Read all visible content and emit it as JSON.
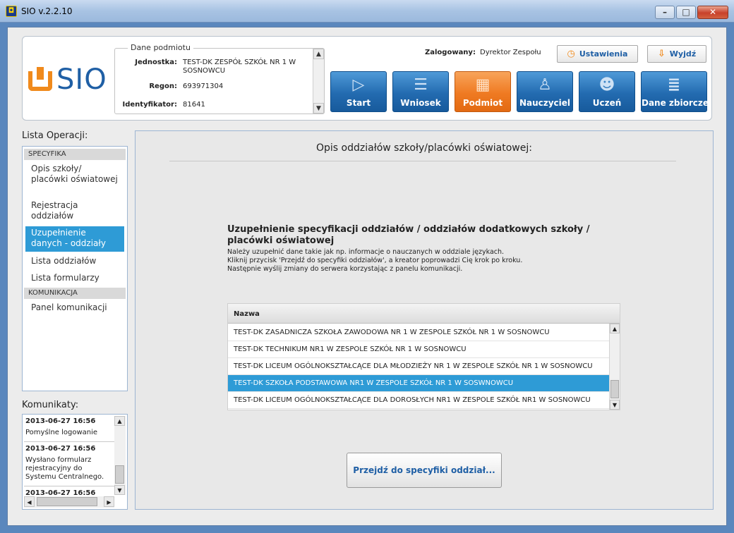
{
  "window": {
    "title": "SIO v.2.2.10"
  },
  "logo": {
    "text": "SIO"
  },
  "header": {
    "dane_title": "Dane podmiotu",
    "fields": [
      {
        "label": "Jednostka:",
        "value": "TEST-DK ZESPÓŁ SZKÓŁ NR 1 W SOSNOWCU"
      },
      {
        "label": "Regon:",
        "value": "693971304"
      },
      {
        "label": "Identyfikator:",
        "value": "81641"
      }
    ],
    "logged_label": "Zalogowany:",
    "logged_user": "Dyrektor Zespołu",
    "settings_label": "Ustawienia",
    "exit_label": "Wyjdź",
    "nav": [
      {
        "label": "Start",
        "icon": "play-icon"
      },
      {
        "label": "Wniosek",
        "icon": "database-icon"
      },
      {
        "label": "Podmiot",
        "icon": "building-icon",
        "active": true
      },
      {
        "label": "Nauczyciel",
        "icon": "teacher-icon"
      },
      {
        "label": "Uczeń",
        "icon": "student-icon"
      },
      {
        "label": "Dane zbiorcze",
        "icon": "stack-icon"
      }
    ]
  },
  "sidebar": {
    "title": "Lista Operacji:",
    "sections": [
      {
        "label": "SPECYFIKA"
      },
      {
        "label": "KOMUNIKACJA"
      }
    ],
    "items": [
      {
        "label": "Opis szkoły/ placówki oświatowej"
      },
      {
        "label": "Rejestracja oddziałów"
      },
      {
        "label": "Uzupełnienie danych - oddziały",
        "active": true
      },
      {
        "label": "Lista oddziałów"
      },
      {
        "label": "Lista formularzy"
      },
      {
        "label": "Panel komunikacji"
      }
    ]
  },
  "messages": {
    "title": "Komunikaty:",
    "items": [
      {
        "time": "2013-06-27 16:56",
        "text": "Pomyślne logowanie"
      },
      {
        "time": "2013-06-27 16:56",
        "text": "Wysłano formularz rejestracyjny do Systemu Centralnego."
      },
      {
        "time": "2013-06-27 16:56",
        "text": ""
      }
    ]
  },
  "main": {
    "title": "Opis oddziałów szkoły/placówki oświatowej:",
    "spec_title": "Uzupełnienie specyfikacji oddziałów / oddziałów dodatkowych szkoły / placówki oświatowej",
    "desc": [
      "Należy uzupełnić dane takie jak np. informacje o nauczanych w oddziale językach.",
      "Kliknij przycisk 'Przejdź do specyfiki oddziałów', a kreator poprowadzi Cię krok po kroku.",
      "Następnie wyślij zmiany do serwera korzystając z panelu komunikacji."
    ],
    "table": {
      "header": "Nazwa",
      "rows": [
        "TEST-DK ZASADNICZA SZKOŁA ZAWODOWA NR 1 W ZESPOLE SZKÓŁ NR 1 W SOSNOWCU",
        "TEST-DK TECHNIKUM NR1 W ZESPOLE SZKÓŁ NR 1 W SOSNOWCU",
        "TEST-DK LICEUM OGÓLNOKSZTAŁCĄCE DLA MŁODZIEŻY NR 1 W ZESPOLE SZKÓŁ NR 1 W SOSNOWCU",
        "TEST-DK SZKOŁA PODSTAWOWA NR1 W ZESPOLE SZKÓŁ NR 1 W SOSWNOWCU",
        "TEST-DK LICEUM OGÓLNOKSZTAŁCĄCE DLA DOROSŁYCH NR1 W ZESPOLE SZKÓŁ NR1 W SOSNOWCU"
      ],
      "selected": 3
    },
    "go_label": "Przejdź do specyfiki oddział..."
  },
  "colors": {
    "accent": "#2e9bd6",
    "nav_blue": "#236bb0",
    "nav_active": "#ef7a22",
    "brand": "#1f5fa5",
    "logo_orange": "#f08a1c"
  }
}
